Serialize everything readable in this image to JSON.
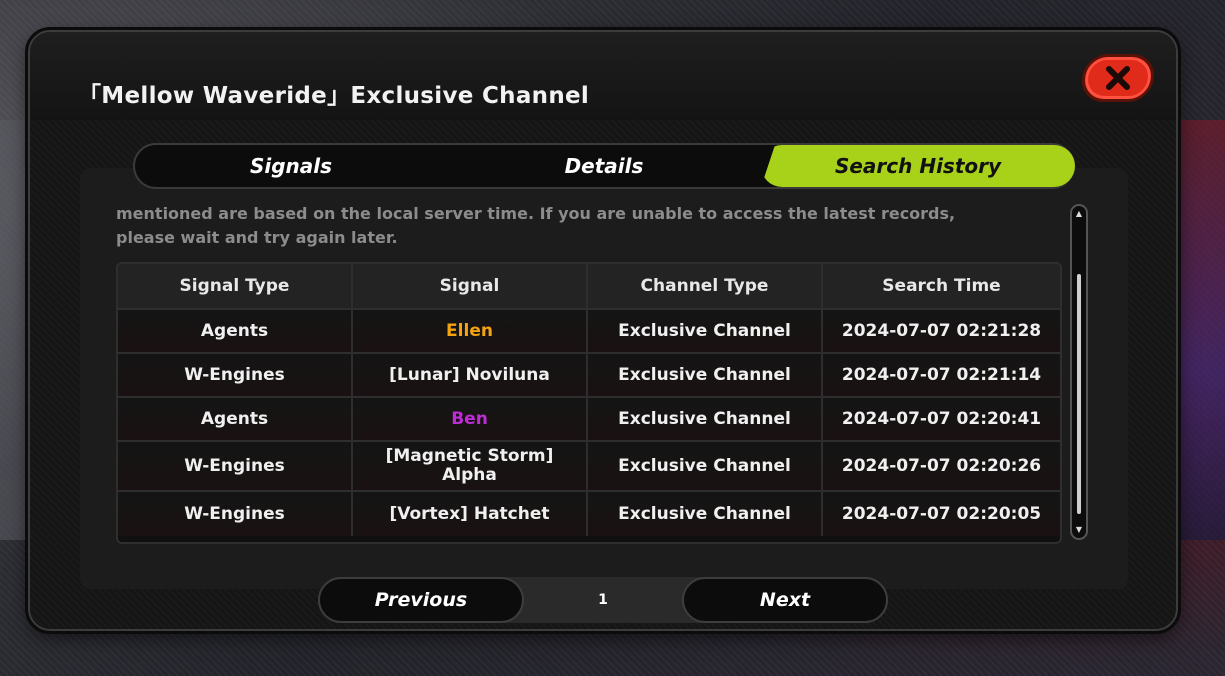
{
  "modal": {
    "title": "「Mellow Waveride」Exclusive Channel"
  },
  "tabs": [
    {
      "label": "Signals",
      "active": false
    },
    {
      "label": "Details",
      "active": false
    },
    {
      "label": "Search History",
      "active": true
    }
  ],
  "notice": {
    "line1": "mentioned are based on the local server time. If you are unable to access the latest records,",
    "line2": "please wait and try again later."
  },
  "table": {
    "headers": [
      "Signal Type",
      "Signal",
      "Channel Type",
      "Search Time"
    ],
    "rows": [
      {
        "type": "Agents",
        "signal": "Ellen",
        "channel": "Exclusive Channel",
        "time": "2024-07-07 02:21:28",
        "signal_color": "#f5a310"
      },
      {
        "type": "W-Engines",
        "signal": "[Lunar] Noviluna",
        "channel": "Exclusive Channel",
        "time": "2024-07-07 02:21:14"
      },
      {
        "type": "Agents",
        "signal": "Ben",
        "channel": "Exclusive Channel",
        "time": "2024-07-07 02:20:41",
        "signal_color": "#c02bd8"
      },
      {
        "type": "W-Engines",
        "signal_line1": "[Magnetic Storm]",
        "signal_line2": "Alpha",
        "channel": "Exclusive Channel",
        "time": "2024-07-07 02:20:26"
      },
      {
        "type": "W-Engines",
        "signal": "[Vortex] Hatchet",
        "channel": "Exclusive Channel",
        "time": "2024-07-07 02:20:05"
      }
    ]
  },
  "pager": {
    "previous_label": "Previous",
    "page": "1",
    "next_label": "Next"
  },
  "colors": {
    "accent": "#a8d11a",
    "close": "#e02a1a",
    "rarity_s": "#f5a310",
    "rarity_a": "#c02bd8"
  },
  "icons": {
    "close": "close-x-icon",
    "scroll_up": "scroll-up-arrow-icon",
    "scroll_down": "scroll-down-arrow-icon"
  }
}
